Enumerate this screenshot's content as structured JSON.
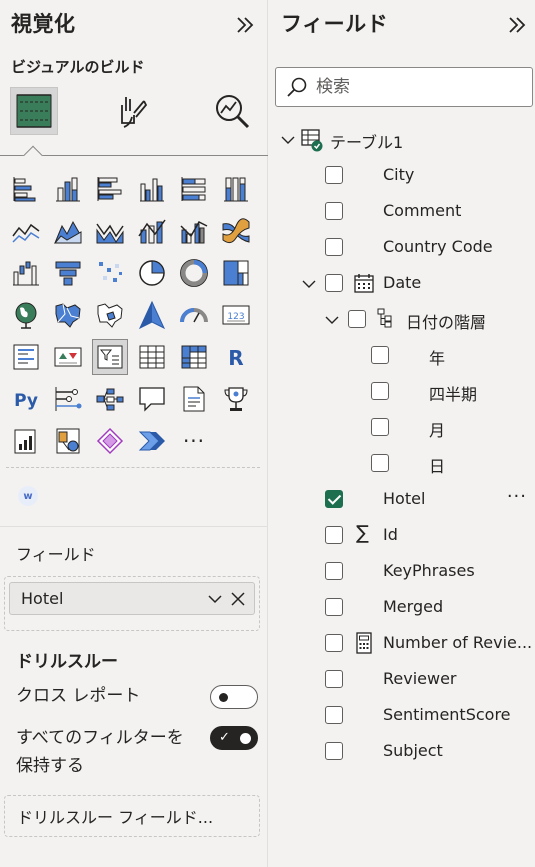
{
  "visualizations_pane": {
    "title": "視覚化",
    "collapse_icon": "double-chevron-right-icon",
    "build_subtitle": "ビジュアルのビルド",
    "tabs": [
      {
        "name": "build-visual",
        "icon": "table-build-icon",
        "active": true
      },
      {
        "name": "format-visual",
        "icon": "paintbrush-icon",
        "active": false
      },
      {
        "name": "analytics",
        "icon": "magnifier-chart-icon",
        "active": false
      }
    ],
    "visual_types": [
      "stacked-bar-chart-icon",
      "stacked-column-chart-icon",
      "clustered-bar-chart-icon",
      "clustered-column-chart-icon",
      "100-stacked-bar-chart-icon",
      "100-stacked-column-chart-icon",
      "line-chart-icon",
      "area-chart-icon",
      "stacked-area-chart-icon",
      "line-and-column-chart-icon",
      "line-and-clustered-column-chart-icon",
      "ribbon-chart-icon",
      "waterfall-chart-icon",
      "funnel-chart-icon",
      "scatter-chart-icon",
      "pie-chart-icon",
      "donut-chart-icon",
      "treemap-icon",
      "map-icon",
      "filled-map-icon",
      "shape-map-icon",
      "azure-map-icon",
      "gauge-icon",
      "card-icon",
      "multi-row-card-icon",
      "kpi-icon",
      "slicer-icon",
      "table-icon",
      "matrix-icon",
      "r-visual-icon",
      "python-visual-icon",
      "key-influencers-icon",
      "decomposition-tree-icon",
      "qa-icon",
      "paginated-report-icon",
      "metrics-icon",
      "power-apps-icon",
      "arcgis-icon",
      "power-apps-icon-2",
      "power-automate-icon",
      "more-visuals-icon"
    ],
    "selected_visual_index": 26,
    "more_label": "···",
    "custom_visual_label": "w",
    "fields_label": "フィールド",
    "field_pill": {
      "label": "Hotel",
      "expand_icon": "chevron-down-icon",
      "remove_icon": "close-icon"
    },
    "drillthrough": {
      "title": "ドリルスルー",
      "cross_report_label": "クロス レポート",
      "cross_report_on": false,
      "keep_filters_label_line1": "すべてのフィルターを",
      "keep_filters_label_line2": "保持する",
      "keep_filters_on": true,
      "field_placeholder": "ドリルスルー フィールド..."
    }
  },
  "fields_pane": {
    "title": "フィールド",
    "collapse_icon": "double-chevron-right-icon",
    "search_placeholder": "検索",
    "search_icon": "search-icon",
    "table": {
      "name": "テーブル1",
      "icon": "table-icon",
      "expanded": true
    },
    "fields": [
      {
        "label": "City",
        "checked": false
      },
      {
        "label": "Comment",
        "checked": false
      },
      {
        "label": "Country Code",
        "checked": false
      },
      {
        "label": "Date",
        "checked": false,
        "icon": "calendar-icon",
        "expanded": true
      },
      {
        "label": "日付の階層",
        "checked": false,
        "icon": "hierarchy-icon",
        "expanded": true
      },
      {
        "label": "年",
        "checked": false
      },
      {
        "label": "四半期",
        "checked": false
      },
      {
        "label": "月",
        "checked": false
      },
      {
        "label": "日",
        "checked": false
      },
      {
        "label": "Hotel",
        "checked": true,
        "more": "···"
      },
      {
        "label": "Id",
        "checked": false,
        "icon": "sigma-icon"
      },
      {
        "label": "KeyPhrases",
        "checked": false
      },
      {
        "label": "Merged",
        "checked": false
      },
      {
        "label": "Number of Revie...",
        "checked": false,
        "icon": "calculator-icon"
      },
      {
        "label": "Reviewer",
        "checked": false
      },
      {
        "label": "SentimentScore",
        "checked": false
      },
      {
        "label": "Subject",
        "checked": false
      }
    ]
  },
  "colors": {
    "accent_green": "#1e6f50",
    "viz_blue": "#4a7fd1",
    "text": "#252423",
    "pane_bg": "#f3f2f1"
  }
}
